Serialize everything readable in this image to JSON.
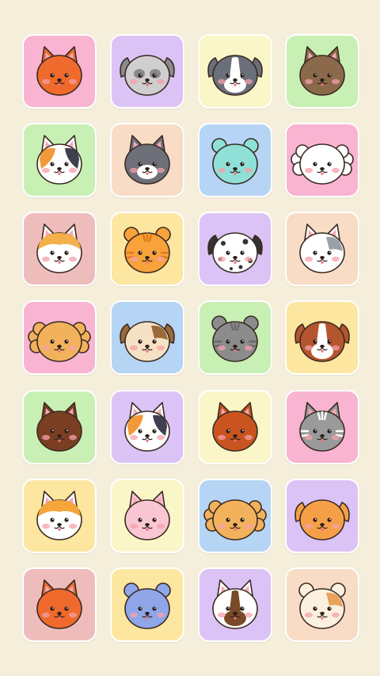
{
  "palette": {
    "pink": "#f8b4d0",
    "lavender": "#dcc3f5",
    "cream": "#fbf6c8",
    "mint": "#c9f0b4",
    "peach": "#f9dcc6",
    "sky": "#b6d4f4",
    "yellow": "#fce6a0",
    "rose": "#efbcbc"
  },
  "stickers": [
    {
      "animal": "red-panda-icon",
      "bg": "pink",
      "fur": "#ef6a2c",
      "accent": "#ffffff",
      "ears": "pointy",
      "spot": "none"
    },
    {
      "animal": "shih-tzu-icon",
      "bg": "lavender",
      "fur": "#cfcfcf",
      "accent": "#8a8a8a",
      "ears": "floppy",
      "spot": "mask"
    },
    {
      "animal": "border-collie-icon",
      "bg": "cream",
      "fur": "#6a6f7a",
      "accent": "#ffffff",
      "ears": "floppy",
      "spot": "blaze"
    },
    {
      "animal": "tabby-cat-icon",
      "bg": "mint",
      "fur": "#8a6a4a",
      "accent": "#a9896b",
      "ears": "pointy",
      "spot": "none"
    },
    {
      "animal": "calico-cat-icon",
      "bg": "mint",
      "fur": "#ffffff",
      "accent": "#f29a3a",
      "ears": "pointy",
      "spot": "calico"
    },
    {
      "animal": "gray-cat-icon",
      "bg": "peach",
      "fur": "#6d7078",
      "accent": "#ffffff",
      "ears": "pointy",
      "spot": "muzzle"
    },
    {
      "animal": "mint-cat-icon",
      "bg": "sky",
      "fur": "#8fe0d6",
      "accent": "#b8efe8",
      "ears": "round",
      "spot": "none"
    },
    {
      "animal": "maltese-dog-icon",
      "bg": "pink",
      "fur": "#ffffff",
      "accent": "#eeeeee",
      "ears": "fluffy",
      "spot": "none"
    },
    {
      "animal": "cream-cat-icon",
      "bg": "rose",
      "fur": "#ffffff",
      "accent": "#f4b04a",
      "ears": "pointy",
      "spot": "cap"
    },
    {
      "animal": "orange-tabby-icon",
      "bg": "yellow",
      "fur": "#f7a23a",
      "accent": "#e07a1a",
      "ears": "round",
      "spot": "stripes"
    },
    {
      "animal": "dalmatian-icon",
      "bg": "lavender",
      "fur": "#ffffff",
      "accent": "#333333",
      "ears": "floppy",
      "spot": "dots"
    },
    {
      "animal": "silver-cat-icon",
      "bg": "peach",
      "fur": "#ffffff",
      "accent": "#9aa0a8",
      "ears": "pointy",
      "spot": "patch"
    },
    {
      "animal": "poodle-icon",
      "bg": "pink",
      "fur": "#f2b25c",
      "accent": "#e59a3c",
      "ears": "fluffy",
      "spot": "none"
    },
    {
      "animal": "pug-mix-icon",
      "bg": "sky",
      "fur": "#f5e1c4",
      "accent": "#9a6a3a",
      "ears": "floppy",
      "spot": "patch"
    },
    {
      "animal": "striped-cat-icon",
      "bg": "mint",
      "fur": "#8c8c8c",
      "accent": "#6a6a6a",
      "ears": "round",
      "spot": "stripes"
    },
    {
      "animal": "brown-dog-icon",
      "bg": "yellow",
      "fur": "#b5552e",
      "accent": "#ffffff",
      "ears": "floppy",
      "spot": "blaze"
    },
    {
      "animal": "yorkie-icon",
      "bg": "mint",
      "fur": "#7a3f22",
      "accent": "#9c5a34",
      "ears": "pointy",
      "spot": "none"
    },
    {
      "animal": "tricolor-cat-icon",
      "bg": "lavender",
      "fur": "#ffffff",
      "accent": "#f29a3a",
      "ears": "pointy",
      "spot": "calico"
    },
    {
      "animal": "pomeranian-icon",
      "bg": "cream",
      "fur": "#c9541f",
      "accent": "#e0773a",
      "ears": "pointy",
      "spot": "none"
    },
    {
      "animal": "gray-tabby-icon",
      "bg": "pink",
      "fur": "#9a9a9a",
      "accent": "#ffffff",
      "ears": "pointy",
      "spot": "stripes"
    },
    {
      "animal": "shiba-icon",
      "bg": "yellow",
      "fur": "#ffffff",
      "accent": "#f5a53a",
      "ears": "pointy",
      "spot": "cap"
    },
    {
      "animal": "pink-cat-icon",
      "bg": "cream",
      "fur": "#f9c6d4",
      "accent": "#f4a9be",
      "ears": "pointy",
      "spot": "none"
    },
    {
      "animal": "apricot-poodle-icon",
      "bg": "sky",
      "fur": "#f2b25c",
      "accent": "#e59a3c",
      "ears": "fluffy",
      "spot": "none"
    },
    {
      "animal": "orange-dog-icon",
      "bg": "lavender",
      "fur": "#f5a048",
      "accent": "#ffffff",
      "ears": "floppy",
      "spot": "none"
    },
    {
      "animal": "fox-icon",
      "bg": "rose",
      "fur": "#ef6a2c",
      "accent": "#ffffff",
      "ears": "pointy",
      "spot": "none"
    },
    {
      "animal": "blue-cat-icon",
      "bg": "yellow",
      "fur": "#8fa6e8",
      "accent": "#b7c6f2",
      "ears": "round",
      "spot": "none"
    },
    {
      "animal": "husky-pup-icon",
      "bg": "lavender",
      "fur": "#ffffff",
      "accent": "#7a4a26",
      "ears": "pointy",
      "spot": "blaze"
    },
    {
      "animal": "beige-cat-icon",
      "bg": "peach",
      "fur": "#fbf1de",
      "accent": "#e8a25a",
      "ears": "round",
      "spot": "patch"
    }
  ]
}
